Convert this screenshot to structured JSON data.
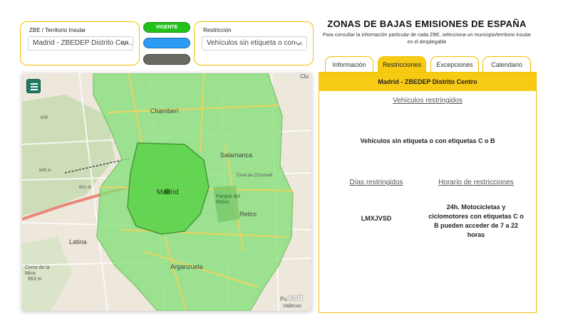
{
  "zbe_selector": {
    "label": "ZBE / Territorio Insular",
    "value": "Madrid - ZBEDEP Distrito Cen..."
  },
  "status_pills": [
    {
      "label": "VIGENTE",
      "color": "#22c21a"
    },
    {
      "label": "",
      "color": "#2b9bf4"
    },
    {
      "label": "",
      "color": "#6b6b63"
    }
  ],
  "restriction_selector": {
    "label": "Restricción",
    "value": "Vehículos sin etiqueta o con ..."
  },
  "map": {
    "labels": {
      "chamberi": "Chamberí",
      "salamanca": "Salamanca",
      "madrid": "Madrid",
      "parque_retiro": "Parque del Retiro",
      "retiro": "Retiro",
      "latina": "Latina",
      "arganzuela": "Arganzuela",
      "cerro": "Cerro de la Mica",
      "cerro_elev": "663 m",
      "vallecas": "Vallecas",
      "puente": "Pu",
      "tunel": "Túnel de O'Donnell",
      "clu": "Clu",
      "elev_609": "609",
      "elev_645": "645 m",
      "elev_601": "601 m",
      "esri": "esri"
    },
    "colors": {
      "outer_zone": "#86e07a",
      "inner_zone": "#5fd44c",
      "roads": "#f5d35a"
    }
  },
  "header": {
    "title": "ZONAS DE BAJAS EMISIONES DE ESPAÑA",
    "subtitle": "Para consultar la información particular de cada ZBE, selecciona un municipio/territorio insular en el desplegable"
  },
  "tabs": [
    {
      "label": "Información",
      "active": false
    },
    {
      "label": "Restricciones",
      "active": true
    },
    {
      "label": "Excepciones",
      "active": false
    },
    {
      "label": "Calendario",
      "active": false
    }
  ],
  "detail": {
    "zone_name": "Madrid - ZBEDEP Distrito Centro",
    "vehicles_title": "Vehículos restringidos",
    "vehicles_text": "Vehículos sin etiqueta o con etiquetas C o B",
    "days_title": "Días restringidos",
    "days_value": "LMXJVSD",
    "hours_title": "Horario de restricciones",
    "hours_value": "24h. Motocicletas y ciclomotores con etiquetas C o B pueden acceder de 7 a 22 horas"
  }
}
